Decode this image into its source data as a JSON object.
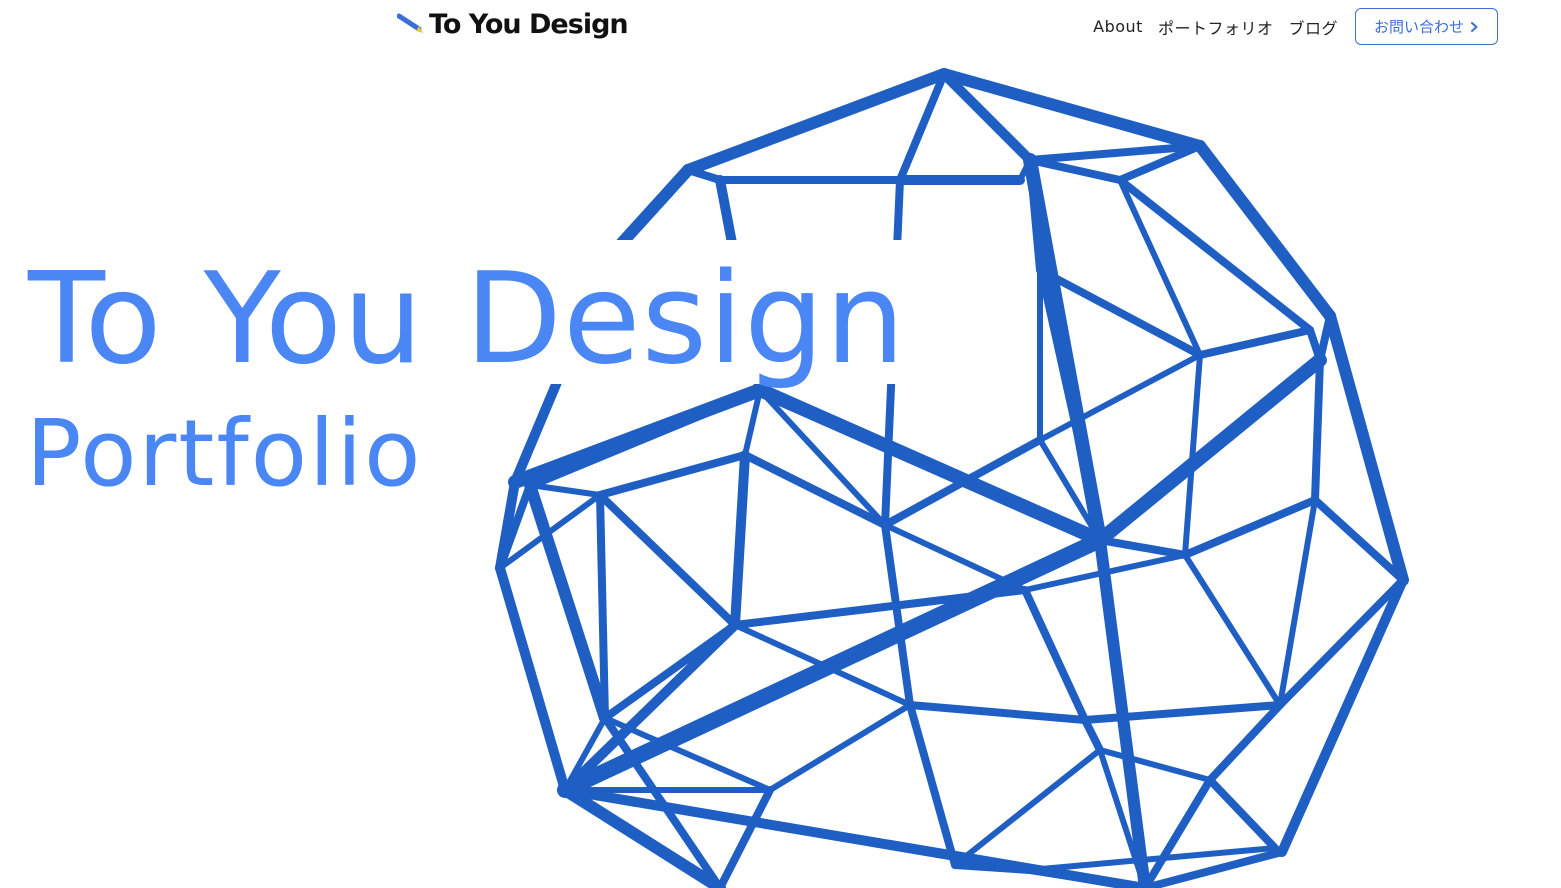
{
  "brand": {
    "name": "To You Design",
    "accent": "#4a86f4",
    "primary": "#1f5fc4"
  },
  "nav": {
    "items": [
      {
        "label": "About"
      },
      {
        "label": "ポートフォリオ"
      },
      {
        "label": "ブログ"
      }
    ],
    "contact_label": "お問い合わせ",
    "contact_icon": "chevron-right-icon"
  },
  "hero": {
    "title": "To You Design",
    "subtitle": "Portfolio",
    "background_graphic": "geodesic-sphere-wireframe"
  }
}
